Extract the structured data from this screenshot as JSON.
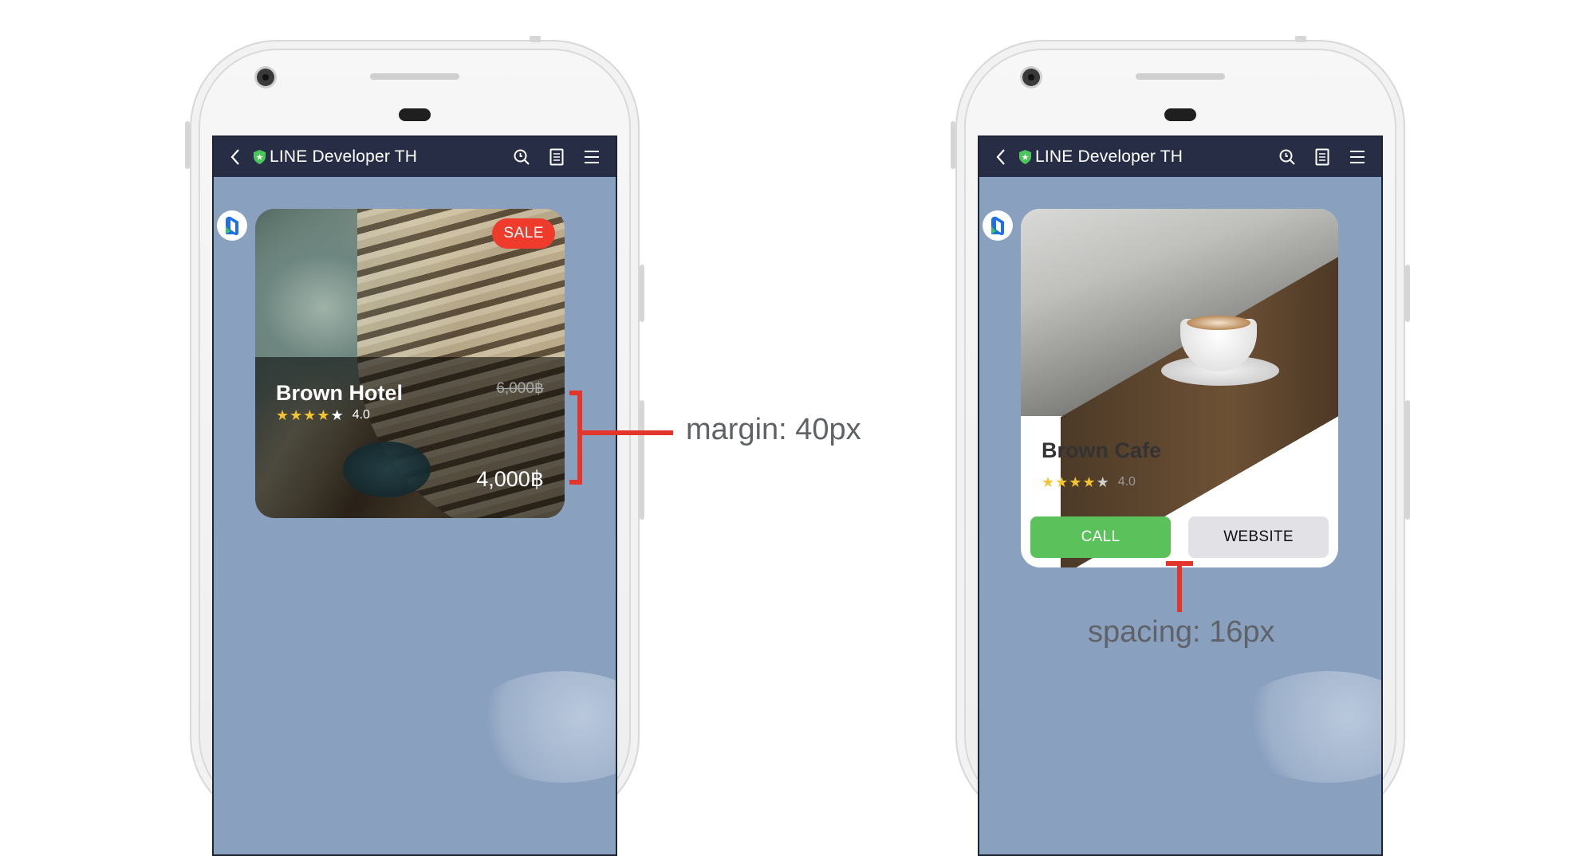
{
  "chat": {
    "title": "LINE Developer TH"
  },
  "hotel_card": {
    "badge": "SALE",
    "name": "Brown Hotel",
    "rating": 4.0,
    "rating_label": "4.0",
    "stars_filled": 4,
    "stars_total": 5,
    "old_price": "6,000฿",
    "new_price": "4,000฿"
  },
  "cafe_card": {
    "name": "Brown Cafe",
    "rating": 4.0,
    "rating_label": "4.0",
    "stars_filled": 4,
    "stars_total": 5,
    "call_label": "CALL",
    "website_label": "WEBSITE"
  },
  "annotations": {
    "margin": "margin: 40px",
    "spacing": "spacing: 16px"
  },
  "colors": {
    "chat_background": "#8aa0bf",
    "header_background": "#262d45",
    "sale_badge": "#ee3b2c",
    "call_button": "#5ac15b",
    "website_button": "#e1e1e6",
    "star": "#f4c430",
    "annotation": "#e2352b"
  },
  "icons": [
    "back-icon",
    "shield-icon",
    "search-icon",
    "notes-icon",
    "menu-icon",
    "avatar-logo-icon",
    "star-icon"
  ]
}
